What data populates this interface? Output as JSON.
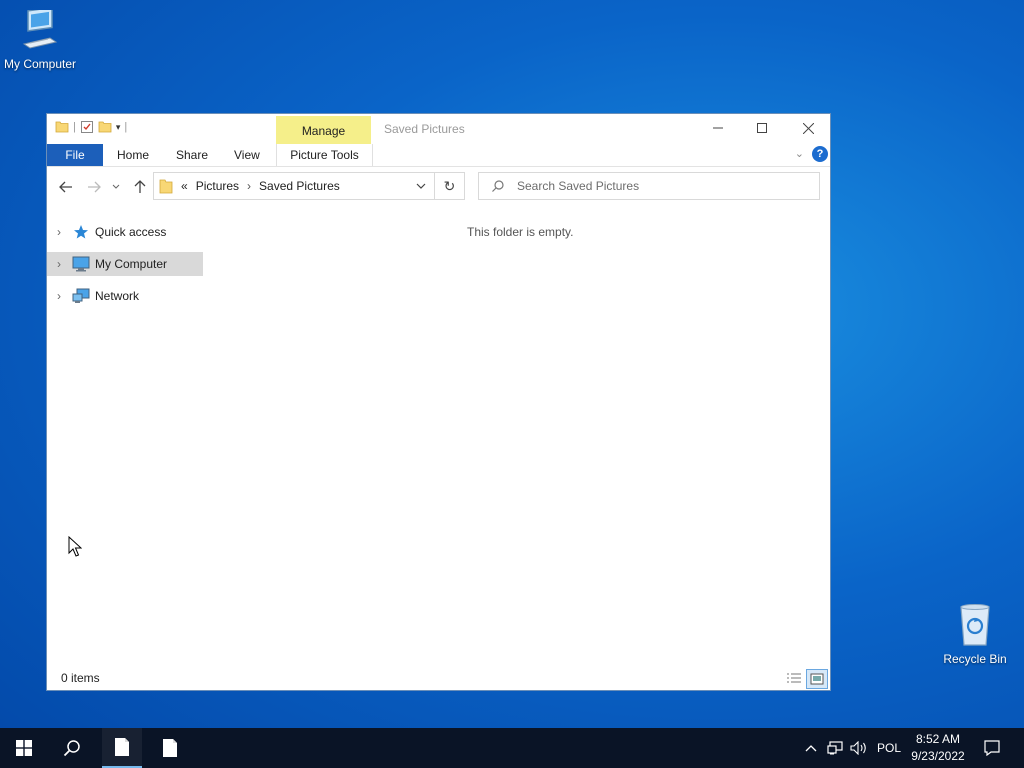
{
  "desktop": {
    "icons": [
      {
        "label": "My Computer"
      },
      {
        "label": "Recycle Bin"
      }
    ]
  },
  "window": {
    "title": "Saved Pictures",
    "contextual_tab_group": "Manage",
    "ribbon_tabs": [
      "File",
      "Home",
      "Share",
      "View",
      "Picture Tools"
    ],
    "address": {
      "overflow": "«",
      "crumbs": [
        "Pictures",
        "Saved Pictures"
      ]
    },
    "search_placeholder": "Search Saved Pictures",
    "nav_items": [
      {
        "label": "Quick access",
        "icon": "star-icon",
        "selected": false
      },
      {
        "label": "My Computer",
        "icon": "computer-icon",
        "selected": true
      },
      {
        "label": "Network",
        "icon": "network-icon",
        "selected": false
      }
    ],
    "empty_message": "This folder is empty.",
    "status": "0 items"
  },
  "taskbar": {
    "language": "POL",
    "time": "8:52 AM",
    "date": "9/23/2022"
  },
  "colors": {
    "file_tab": "#1c5fba",
    "manage_tab": "#f5ef8a",
    "taskbar": "#0a1426"
  }
}
